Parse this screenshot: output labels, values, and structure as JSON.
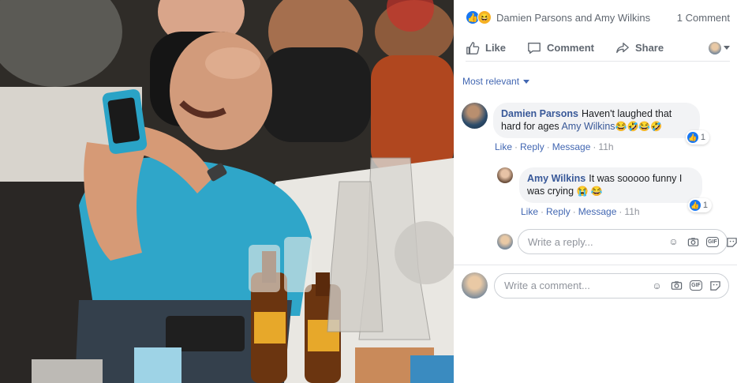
{
  "post": {
    "reaction_names": "Damien Parsons and Amy Wilkins",
    "comment_count": "1 Comment",
    "reaction_icons": [
      "like-icon",
      "haha-icon"
    ]
  },
  "actions": {
    "like_label": "Like",
    "comment_label": "Comment",
    "share_label": "Share"
  },
  "sort": {
    "label": "Most relevant"
  },
  "comments": [
    {
      "author": "Damien Parsons",
      "text": "Haven't laughed that hard for ages",
      "mention": "Amy Wilkins",
      "emojis": "😂🤣😂🤣",
      "like_label": "Like",
      "reply_label": "Reply",
      "message_label": "Message",
      "time": "11h",
      "like_count": "1"
    },
    {
      "author": "Amy Wilkins",
      "text": "It was sooooo funny I was crying",
      "emojis": "😭 😂",
      "like_label": "Like",
      "reply_label": "Reply",
      "message_label": "Message",
      "time": "11h",
      "like_count": "1"
    }
  ],
  "reply_input": {
    "placeholder": "Write a reply..."
  },
  "comment_input": {
    "placeholder": "Write a comment..."
  },
  "colors": {
    "link": "#385898",
    "like_blue": "#1877f2",
    "muted": "#606770",
    "bubble_bg": "#f2f3f5",
    "shirt": "#2fa6c9"
  }
}
